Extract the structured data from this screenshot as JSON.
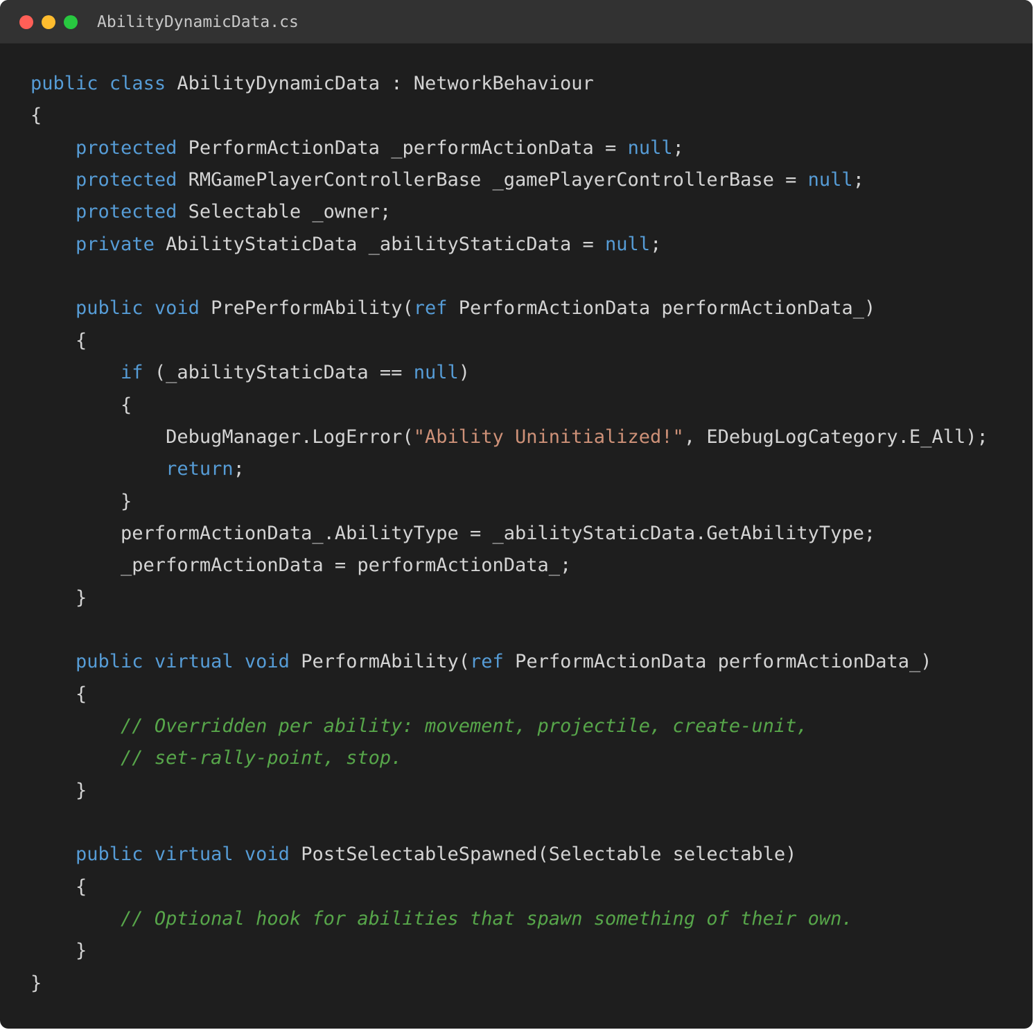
{
  "window": {
    "filename": "AbilityDynamicData.cs",
    "controls": [
      "close",
      "minimize",
      "maximize"
    ]
  },
  "colors": {
    "background": "#1e1e1e",
    "titlebar": "#323232",
    "keyword": "#569cd6",
    "string": "#ce9178",
    "comment": "#57a64a",
    "text": "#d4d4d4"
  },
  "code": {
    "language": "C#",
    "lines": [
      [
        {
          "t": "public",
          "k": "kw"
        },
        {
          "t": " ",
          "k": "tx"
        },
        {
          "t": "class",
          "k": "kw"
        },
        {
          "t": " AbilityDynamicData : NetworkBehaviour",
          "k": "tx"
        }
      ],
      [
        {
          "t": "{",
          "k": "tx"
        }
      ],
      [
        {
          "t": "    ",
          "k": "tx"
        },
        {
          "t": "protected",
          "k": "kw"
        },
        {
          "t": " PerformActionData _performActionData = ",
          "k": "tx"
        },
        {
          "t": "null",
          "k": "kw"
        },
        {
          "t": ";",
          "k": "tx"
        }
      ],
      [
        {
          "t": "    ",
          "k": "tx"
        },
        {
          "t": "protected",
          "k": "kw"
        },
        {
          "t": " RMGamePlayerControllerBase _gamePlayerControllerBase = ",
          "k": "tx"
        },
        {
          "t": "null",
          "k": "kw"
        },
        {
          "t": ";",
          "k": "tx"
        }
      ],
      [
        {
          "t": "    ",
          "k": "tx"
        },
        {
          "t": "protected",
          "k": "kw"
        },
        {
          "t": " Selectable _owner;",
          "k": "tx"
        }
      ],
      [
        {
          "t": "    ",
          "k": "tx"
        },
        {
          "t": "private",
          "k": "kw"
        },
        {
          "t": " AbilityStaticData _abilityStaticData = ",
          "k": "tx"
        },
        {
          "t": "null",
          "k": "kw"
        },
        {
          "t": ";",
          "k": "tx"
        }
      ],
      [],
      [
        {
          "t": "    ",
          "k": "tx"
        },
        {
          "t": "public",
          "k": "kw"
        },
        {
          "t": " ",
          "k": "tx"
        },
        {
          "t": "void",
          "k": "kw"
        },
        {
          "t": " PrePerformAbility(",
          "k": "tx"
        },
        {
          "t": "ref",
          "k": "kw"
        },
        {
          "t": " PerformActionData performActionData_)",
          "k": "tx"
        }
      ],
      [
        {
          "t": "    {",
          "k": "tx"
        }
      ],
      [
        {
          "t": "        ",
          "k": "tx"
        },
        {
          "t": "if",
          "k": "kw"
        },
        {
          "t": " (_abilityStaticData == ",
          "k": "tx"
        },
        {
          "t": "null",
          "k": "kw"
        },
        {
          "t": ")",
          "k": "tx"
        }
      ],
      [
        {
          "t": "        {",
          "k": "tx"
        }
      ],
      [
        {
          "t": "            DebugManager.LogError(",
          "k": "tx"
        },
        {
          "t": "\"Ability Uninitialized!\"",
          "k": "str"
        },
        {
          "t": ", EDebugLogCategory.E_All);",
          "k": "tx"
        }
      ],
      [
        {
          "t": "            ",
          "k": "tx"
        },
        {
          "t": "return",
          "k": "kw"
        },
        {
          "t": ";",
          "k": "tx"
        }
      ],
      [
        {
          "t": "        }",
          "k": "tx"
        }
      ],
      [
        {
          "t": "        performActionData_.AbilityType = _abilityStaticData.GetAbilityType;",
          "k": "tx"
        }
      ],
      [
        {
          "t": "        _performActionData = performActionData_;",
          "k": "tx"
        }
      ],
      [
        {
          "t": "    }",
          "k": "tx"
        }
      ],
      [],
      [
        {
          "t": "    ",
          "k": "tx"
        },
        {
          "t": "public",
          "k": "kw"
        },
        {
          "t": " ",
          "k": "tx"
        },
        {
          "t": "virtual",
          "k": "kw"
        },
        {
          "t": " ",
          "k": "tx"
        },
        {
          "t": "void",
          "k": "kw"
        },
        {
          "t": " PerformAbility(",
          "k": "tx"
        },
        {
          "t": "ref",
          "k": "kw"
        },
        {
          "t": " PerformActionData performActionData_)",
          "k": "tx"
        }
      ],
      [
        {
          "t": "    {",
          "k": "tx"
        }
      ],
      [
        {
          "t": "        ",
          "k": "tx"
        },
        {
          "t": "// Overridden per ability: movement, projectile, create-unit,",
          "k": "cm"
        }
      ],
      [
        {
          "t": "        ",
          "k": "tx"
        },
        {
          "t": "// set-rally-point, stop.",
          "k": "cm"
        }
      ],
      [
        {
          "t": "    }",
          "k": "tx"
        }
      ],
      [],
      [
        {
          "t": "    ",
          "k": "tx"
        },
        {
          "t": "public",
          "k": "kw"
        },
        {
          "t": " ",
          "k": "tx"
        },
        {
          "t": "virtual",
          "k": "kw"
        },
        {
          "t": " ",
          "k": "tx"
        },
        {
          "t": "void",
          "k": "kw"
        },
        {
          "t": " PostSelectableSpawned(Selectable selectable)",
          "k": "tx"
        }
      ],
      [
        {
          "t": "    {",
          "k": "tx"
        }
      ],
      [
        {
          "t": "        ",
          "k": "tx"
        },
        {
          "t": "// Optional hook for abilities that spawn something of their own.",
          "k": "cm"
        }
      ],
      [
        {
          "t": "    }",
          "k": "tx"
        }
      ],
      [
        {
          "t": "}",
          "k": "tx"
        }
      ]
    ]
  }
}
